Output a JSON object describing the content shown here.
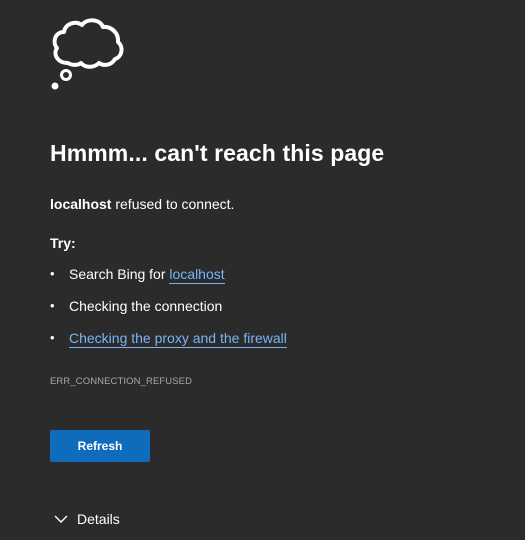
{
  "icon": {
    "name": "thought-cloud-icon"
  },
  "title": "Hmmm... can't reach this page",
  "error_message": {
    "host": "localhost",
    "text": " refused to connect."
  },
  "try_label": "Try:",
  "suggestions": [
    {
      "prefix": "Search Bing for ",
      "link": "localhost"
    },
    {
      "text": "Checking the connection"
    },
    {
      "link": "Checking the proxy and the firewall"
    }
  ],
  "bullet": "•",
  "error_code": "ERR_CONNECTION_REFUSED",
  "refresh_label": "Refresh",
  "details_label": "Details",
  "colors": {
    "background": "#2b2b2b",
    "link": "#7ab4f5",
    "button": "#0f6cbd",
    "muted_text": "#a8a8a8"
  }
}
